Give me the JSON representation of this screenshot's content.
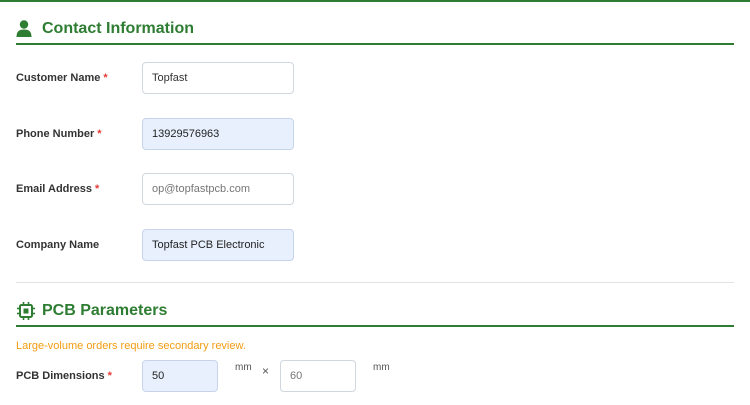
{
  "contact": {
    "title": "Contact Information",
    "icon": "user-icon",
    "fields": [
      {
        "label": "Customer Name",
        "required": "*",
        "value": "Topfast",
        "state": "normal"
      },
      {
        "label": "Phone Number",
        "required": "*",
        "value": "13929576963",
        "state": "autofilled"
      },
      {
        "label": "Email Address",
        "required": "*",
        "placeholder": "op@topfastpcb.com",
        "state": "placeholder"
      },
      {
        "label": "Company Name",
        "value": "Topfast PCB Electronic",
        "state": "autofilled"
      }
    ]
  },
  "pcb": {
    "title": "PCB Parameters",
    "icon": "chip-icon",
    "notice": "Large-volume orders require secondary review.",
    "dimensions": {
      "label": "PCB Dimensions",
      "required": "*",
      "width": "50",
      "length_placeholder": "60",
      "unit": "mm",
      "separator": "×"
    }
  },
  "colors": {
    "accent": "#2e7d32",
    "required": "#e53935",
    "notice": "#f39c12",
    "autofill_bg": "#e8f0fe"
  }
}
